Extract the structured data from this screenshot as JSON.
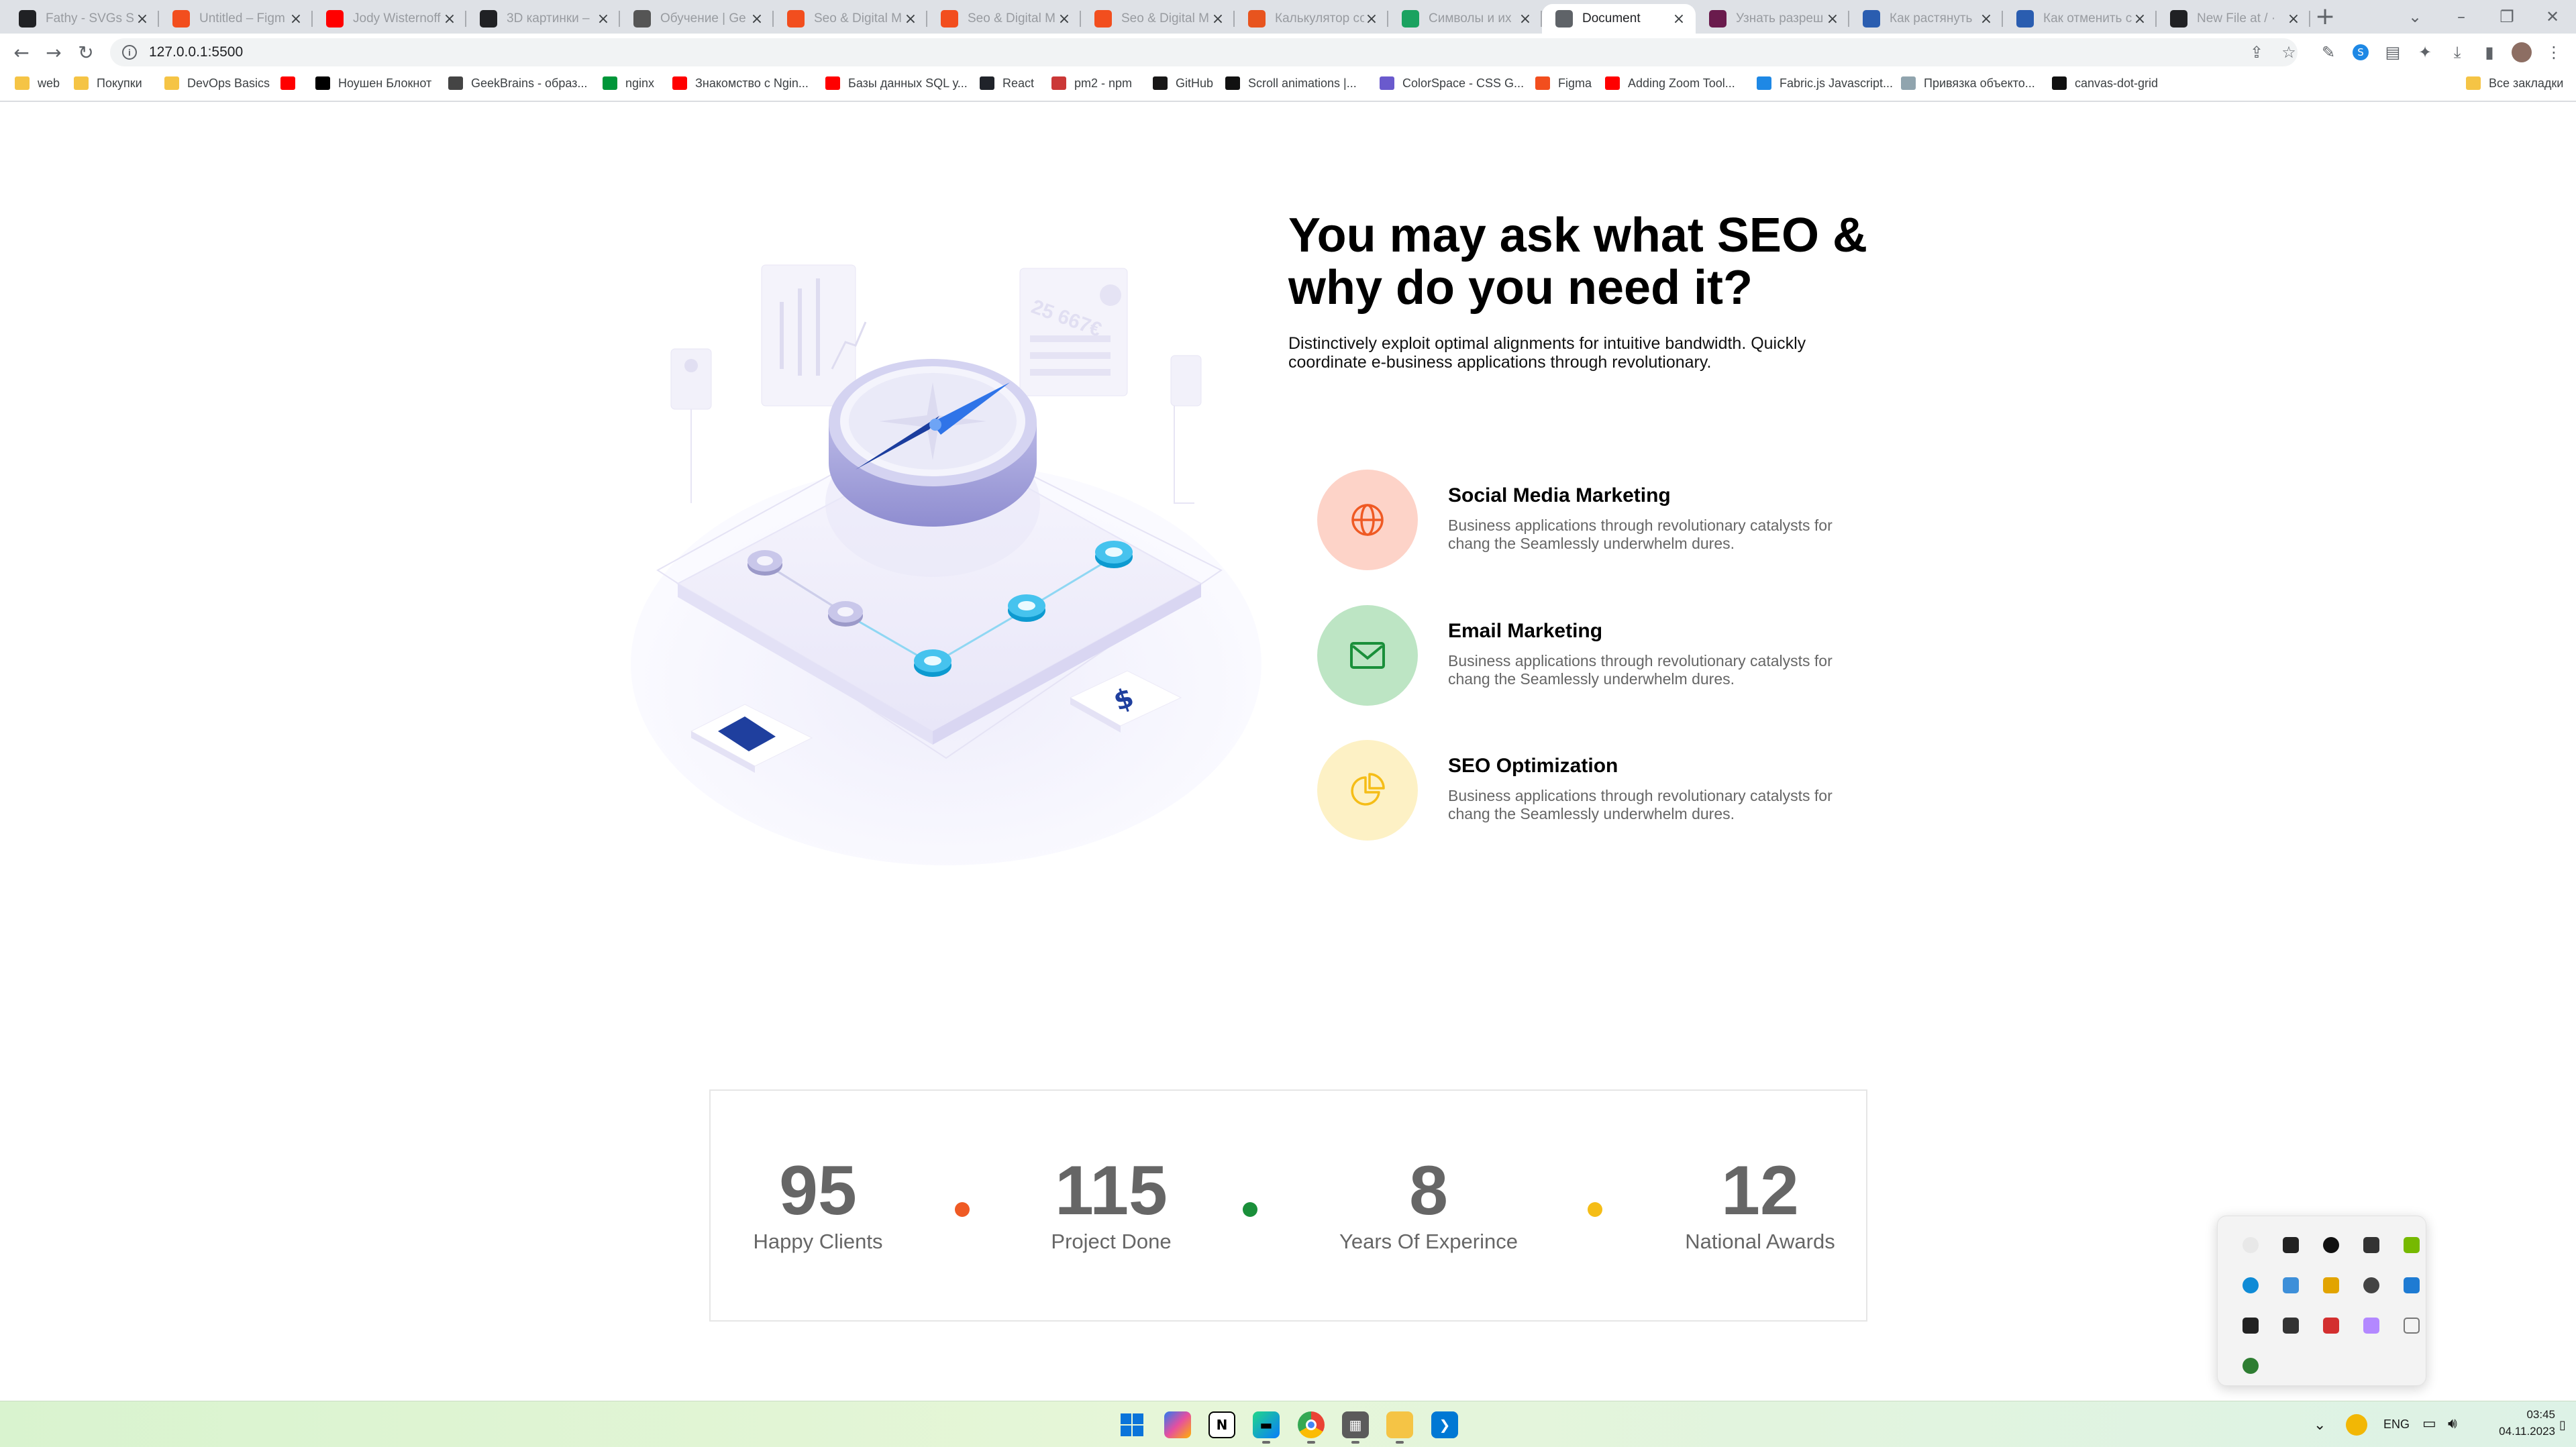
{
  "browser": {
    "tabs": [
      {
        "label": "Fathy - SVGs Sp",
        "icon": "m-logo",
        "color": "#202124"
      },
      {
        "label": "Untitled – Figm",
        "icon": "figma-icon",
        "color": "#f24e1e"
      },
      {
        "label": "Jody Wisternoff",
        "icon": "youtube-icon",
        "color": "#ff0000"
      },
      {
        "label": "3D картинки –",
        "icon": "codepen-icon",
        "color": "#202124"
      },
      {
        "label": "Обучение | Ge",
        "icon": "geekbrains-icon",
        "color": "#555555"
      },
      {
        "label": "Seo & Digital M",
        "icon": "figma-icon",
        "color": "#f24e1e"
      },
      {
        "label": "Seo & Digital M",
        "icon": "figma-icon",
        "color": "#f24e1e"
      },
      {
        "label": "Seo & Digital M",
        "icon": "figma-icon",
        "color": "#f24e1e"
      },
      {
        "label": "Калькулятор со",
        "icon": "calculator-icon",
        "color": "#e8541e"
      },
      {
        "label": "Символы и их",
        "icon": "symbols-icon",
        "color": "#1aa260"
      },
      {
        "label": "Document",
        "icon": "globe-icon",
        "color": "#5f6368",
        "active": true
      },
      {
        "label": "Узнать разреш",
        "icon": "resolution-icon",
        "color": "#6a1b4d"
      },
      {
        "label": "Как растянуть",
        "icon": "gear-icon",
        "color": "#2a5db0"
      },
      {
        "label": "Как отменить с",
        "icon": "stackoverflow-icon",
        "color": "#2a5db0"
      },
      {
        "label": "New File at / ·",
        "icon": "github-icon",
        "color": "#202124"
      }
    ],
    "url": "127.0.0.1:5500",
    "bookmarks": [
      {
        "label": "web",
        "icon": "folder-icon"
      },
      {
        "label": "Покупки",
        "icon": "folder-icon"
      },
      {
        "label": "DevOps Basics",
        "icon": "folder-icon"
      },
      {
        "label": "",
        "icon": "youtube-icon"
      },
      {
        "label": "Ноушен Блокнот",
        "icon": "notion-icon"
      },
      {
        "label": "GeekBrains - образ...",
        "icon": "geekbrains-icon"
      },
      {
        "label": "nginx",
        "icon": "nginx-icon"
      },
      {
        "label": "Знакомство с Ngin...",
        "icon": "youtube-icon"
      },
      {
        "label": "Базы данных SQL у...",
        "icon": "youtube-icon"
      },
      {
        "label": "React",
        "icon": "react-icon"
      },
      {
        "label": "pm2 - npm",
        "icon": "npm-icon"
      },
      {
        "label": "GitHub",
        "icon": "github-icon"
      },
      {
        "label": "Scroll animations |...",
        "icon": "framer-icon"
      },
      {
        "label": "ColorSpace - CSS G...",
        "icon": "colorspace-icon"
      },
      {
        "label": "Figma",
        "icon": "figma-icon"
      },
      {
        "label": "Adding Zoom Tool...",
        "icon": "youtube-icon"
      },
      {
        "label": "Fabric.js Javascript...",
        "icon": "fabric-icon"
      },
      {
        "label": "Привязка объекто...",
        "icon": "cloud-icon"
      },
      {
        "label": "canvas-dot-grid",
        "icon": "codepen-icon"
      }
    ],
    "all_bookmarks": "Все закладки"
  },
  "hero": {
    "heading": "You may ask what SEO & why do you need it?",
    "subtext": "Distinctively exploit optimal alignments for intuitive bandwidth. Quickly coordinate e-business applications through revolutionary.",
    "illustration_label": "25 667€"
  },
  "services": [
    {
      "title": "Social Media Marketing",
      "desc": "Business applications through revolutionary catalysts for chang the Seamlessly underwhelm dures.",
      "icon": "globe-icon",
      "bg": "#fdd3c8",
      "fg": "#ef5a24"
    },
    {
      "title": "Email Marketing",
      "desc": "Business applications through revolutionary catalysts for chang the Seamlessly underwhelm dures.",
      "icon": "mail-icon",
      "bg": "#bde5c4",
      "fg": "#1a8f3a"
    },
    {
      "title": "SEO Optimization",
      "desc": "Business applications through revolutionary catalysts for chang the Seamlessly underwhelm dures.",
      "icon": "pie-chart-icon",
      "bg": "#fdf1c5",
      "fg": "#f5bd17"
    }
  ],
  "stats": [
    {
      "value": "95",
      "label": "Happy Clients"
    },
    {
      "value": "115",
      "label": "Project Done"
    },
    {
      "value": "8",
      "label": "Years Of Experince"
    },
    {
      "value": "12",
      "label": "National Awards"
    }
  ],
  "stat_dot_colors": [
    "#ef5a24",
    "#1a8f3a",
    "#f5bd17"
  ],
  "taskbar": {
    "apps": [
      "windows-start-icon",
      "copilot-icon",
      "notion-icon",
      "pycharm-icon",
      "chrome-icon",
      "calculator-icon",
      "file-explorer-icon",
      "vscode-icon"
    ],
    "language": "ENG",
    "time": "03:45",
    "date": "04.11.2023"
  }
}
